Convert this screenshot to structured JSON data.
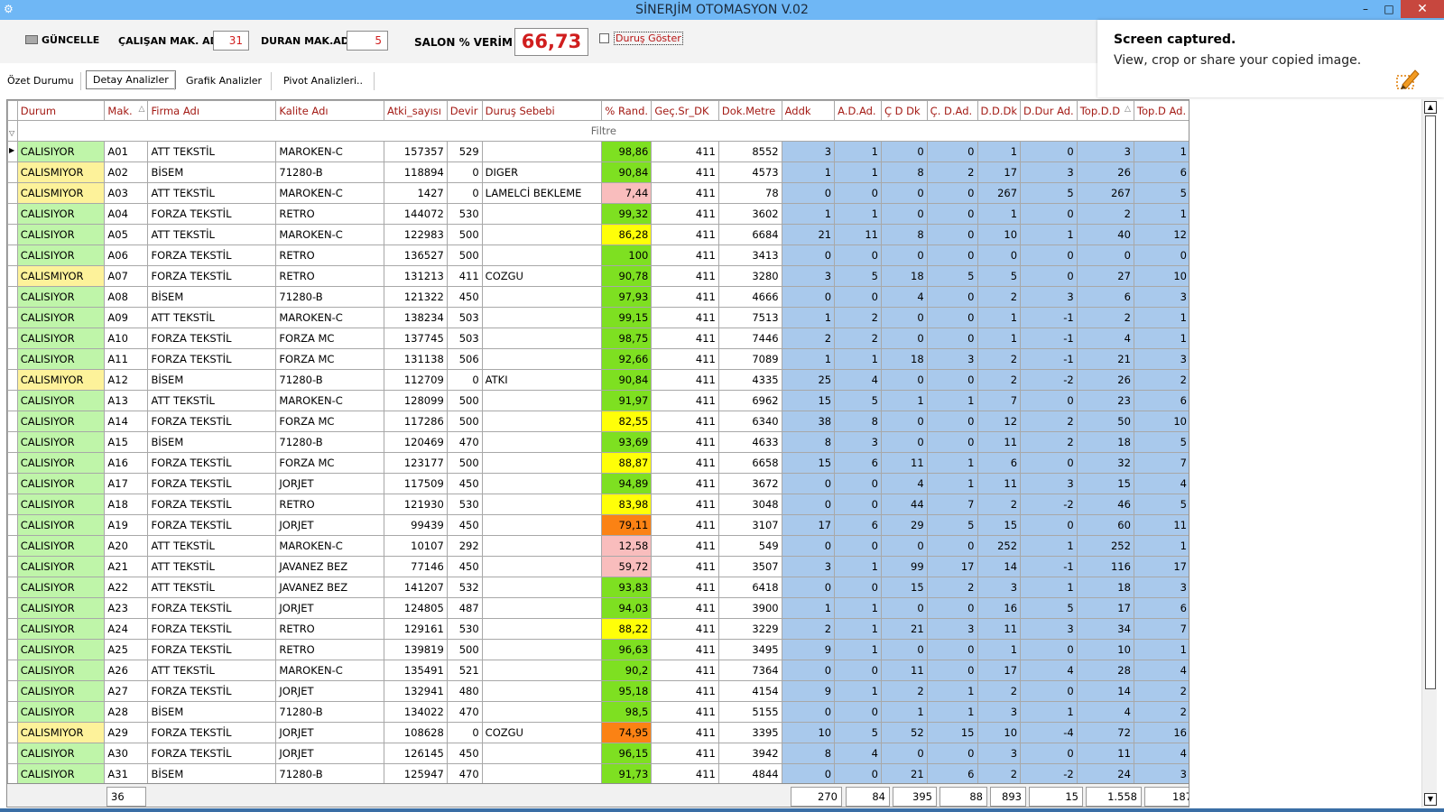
{
  "window": {
    "title": "SİNERJİM OTOMASYON V.02",
    "controls": {
      "minimize": "–",
      "maximize": "□",
      "close": "✕"
    }
  },
  "toolbar": {
    "refresh_label": "GÜNCELLE",
    "running_label": "ÇALIŞAN MAK. AD.",
    "running_value": "31",
    "stopped_label": "DURAN MAK.AD.",
    "stopped_value": "5",
    "efficiency_label": "SALON % VERİM",
    "efficiency_value": "66,73",
    "show_stops_label": "Duruş Göster"
  },
  "tabs": [
    "Özet Durumu",
    "Detay Analizler",
    "Grafik Analizler",
    "Pivot Analizleri.."
  ],
  "active_tab": 1,
  "notification": {
    "title": "Screen captured.",
    "body": "View, crop or share your copied image.",
    "icon": "snip-pen-icon"
  },
  "grid": {
    "filter_label": "Filtre",
    "columns": [
      "Durum",
      "Mak.",
      "Firma Adı",
      "Kalite Adı",
      "Atki_sayısı",
      "Devir",
      "Duruş Sebebi",
      "% Rand.",
      "Geç.Sr_DK",
      "Dok.Metre",
      "Addk",
      "A.D.Ad.",
      "Ç D Dk",
      "Ç. D.Ad.",
      "D.D.Dk",
      "D.Dur Ad.",
      "Top.D.D",
      "Top.D Ad."
    ],
    "sorted_columns": [
      1,
      16
    ],
    "colors": {
      "running": "#bff5a9",
      "stopped": "#fdf29a",
      "green": "#7ee021",
      "yellow": "#ffff08",
      "pink": "#f9bdbd",
      "orange": "#fb8214",
      "blue": "#a9c9ec"
    },
    "rows": [
      {
        "s": "on",
        "c": [
          "CALISIYOR",
          "A01",
          "ATT TEKSTİL",
          "MAROKEN-C",
          "157357",
          "529",
          "",
          "98,86",
          "411",
          "8552",
          "3",
          "1",
          "0",
          "0",
          "1",
          "0",
          "3",
          "1"
        ],
        "r": "green"
      },
      {
        "s": "off",
        "c": [
          "CALISMIYOR",
          "A02",
          "BİSEM",
          "71280-B",
          "118894",
          "0",
          "DIGER",
          "90,84",
          "411",
          "4573",
          "1",
          "1",
          "8",
          "2",
          "17",
          "3",
          "26",
          "6"
        ],
        "r": "green"
      },
      {
        "s": "off",
        "c": [
          "CALISMIYOR",
          "A03",
          "ATT TEKSTİL",
          "MAROKEN-C",
          "1427",
          "0",
          "LAMELCİ BEKLEME",
          "7,44",
          "411",
          "78",
          "0",
          "0",
          "0",
          "0",
          "267",
          "5",
          "267",
          "5"
        ],
        "r": "pink"
      },
      {
        "s": "on",
        "c": [
          "CALISIYOR",
          "A04",
          "FORZA TEKSTİL",
          "RETRO",
          "144072",
          "530",
          "",
          "99,32",
          "411",
          "3602",
          "1",
          "1",
          "0",
          "0",
          "1",
          "0",
          "2",
          "1"
        ],
        "r": "green"
      },
      {
        "s": "on",
        "c": [
          "CALISIYOR",
          "A05",
          "ATT TEKSTİL",
          "MAROKEN-C",
          "122983",
          "500",
          "",
          "86,28",
          "411",
          "6684",
          "21",
          "11",
          "8",
          "0",
          "10",
          "1",
          "40",
          "12"
        ],
        "r": "yellow"
      },
      {
        "s": "on",
        "c": [
          "CALISIYOR",
          "A06",
          "FORZA TEKSTİL",
          "RETRO",
          "136527",
          "500",
          "",
          "100",
          "411",
          "3413",
          "0",
          "0",
          "0",
          "0",
          "0",
          "0",
          "0",
          "0"
        ],
        "r": "green"
      },
      {
        "s": "off",
        "c": [
          "CALISMIYOR",
          "A07",
          "FORZA TEKSTİL",
          "RETRO",
          "131213",
          "411",
          "COZGU",
          "90,78",
          "411",
          "3280",
          "3",
          "5",
          "18",
          "5",
          "5",
          "0",
          "27",
          "10"
        ],
        "r": "green"
      },
      {
        "s": "on",
        "c": [
          "CALISIYOR",
          "A08",
          "BİSEM",
          "71280-B",
          "121322",
          "450",
          "",
          "97,93",
          "411",
          "4666",
          "0",
          "0",
          "4",
          "0",
          "2",
          "3",
          "6",
          "3"
        ],
        "r": "green"
      },
      {
        "s": "on",
        "c": [
          "CALISIYOR",
          "A09",
          "ATT TEKSTİL",
          "MAROKEN-C",
          "138234",
          "503",
          "",
          "99,15",
          "411",
          "7513",
          "1",
          "2",
          "0",
          "0",
          "1",
          "-1",
          "2",
          "1"
        ],
        "r": "green"
      },
      {
        "s": "on",
        "c": [
          "CALISIYOR",
          "A10",
          "FORZA TEKSTİL",
          "FORZA MC",
          "137745",
          "503",
          "",
          "98,75",
          "411",
          "7446",
          "2",
          "2",
          "0",
          "0",
          "1",
          "-1",
          "4",
          "1"
        ],
        "r": "green"
      },
      {
        "s": "on",
        "c": [
          "CALISIYOR",
          "A11",
          "FORZA TEKSTİL",
          "FORZA MC",
          "131138",
          "506",
          "",
          "92,66",
          "411",
          "7089",
          "1",
          "1",
          "18",
          "3",
          "2",
          "-1",
          "21",
          "3"
        ],
        "r": "green"
      },
      {
        "s": "off",
        "c": [
          "CALISMIYOR",
          "A12",
          "BİSEM",
          "71280-B",
          "112709",
          "0",
          "ATKI",
          "90,84",
          "411",
          "4335",
          "25",
          "4",
          "0",
          "0",
          "2",
          "-2",
          "26",
          "2"
        ],
        "r": "green"
      },
      {
        "s": "on",
        "c": [
          "CALISIYOR",
          "A13",
          "ATT TEKSTİL",
          "MAROKEN-C",
          "128099",
          "500",
          "",
          "91,97",
          "411",
          "6962",
          "15",
          "5",
          "1",
          "1",
          "7",
          "0",
          "23",
          "6"
        ],
        "r": "green"
      },
      {
        "s": "on",
        "c": [
          "CALISIYOR",
          "A14",
          "FORZA TEKSTİL",
          "FORZA MC",
          "117286",
          "500",
          "",
          "82,55",
          "411",
          "6340",
          "38",
          "8",
          "0",
          "0",
          "12",
          "2",
          "50",
          "10"
        ],
        "r": "yellow"
      },
      {
        "s": "on",
        "c": [
          "CALISIYOR",
          "A15",
          "BİSEM",
          "71280-B",
          "120469",
          "470",
          "",
          "93,69",
          "411",
          "4633",
          "8",
          "3",
          "0",
          "0",
          "11",
          "2",
          "18",
          "5"
        ],
        "r": "green"
      },
      {
        "s": "on",
        "c": [
          "CALISIYOR",
          "A16",
          "FORZA TEKSTİL",
          "FORZA MC",
          "123177",
          "500",
          "",
          "88,87",
          "411",
          "6658",
          "15",
          "6",
          "11",
          "1",
          "6",
          "0",
          "32",
          "7"
        ],
        "r": "yellow"
      },
      {
        "s": "on",
        "c": [
          "CALISIYOR",
          "A17",
          "FORZA TEKSTİL",
          "JORJET",
          "117509",
          "450",
          "",
          "94,89",
          "411",
          "3672",
          "0",
          "0",
          "4",
          "1",
          "11",
          "3",
          "15",
          "4"
        ],
        "r": "green"
      },
      {
        "s": "on",
        "c": [
          "CALISIYOR",
          "A18",
          "FORZA TEKSTİL",
          "RETRO",
          "121930",
          "530",
          "",
          "83,98",
          "411",
          "3048",
          "0",
          "0",
          "44",
          "7",
          "2",
          "-2",
          "46",
          "5"
        ],
        "r": "yellow"
      },
      {
        "s": "on",
        "c": [
          "CALISIYOR",
          "A19",
          "FORZA TEKSTİL",
          "JORJET",
          "99439",
          "450",
          "",
          "79,11",
          "411",
          "3107",
          "17",
          "6",
          "29",
          "5",
          "15",
          "0",
          "60",
          "11"
        ],
        "r": "orange"
      },
      {
        "s": "on",
        "c": [
          "CALISIYOR",
          "A20",
          "ATT TEKSTİL",
          "MAROKEN-C",
          "10107",
          "292",
          "",
          "12,58",
          "411",
          "549",
          "0",
          "0",
          "0",
          "0",
          "252",
          "1",
          "252",
          "1"
        ],
        "r": "pink"
      },
      {
        "s": "on",
        "c": [
          "CALISIYOR",
          "A21",
          "ATT TEKSTİL",
          "JAVANEZ BEZ",
          "77146",
          "450",
          "",
          "59,72",
          "411",
          "3507",
          "3",
          "1",
          "99",
          "17",
          "14",
          "-1",
          "116",
          "17"
        ],
        "r": "pink"
      },
      {
        "s": "on",
        "c": [
          "CALISIYOR",
          "A22",
          "ATT TEKSTİL",
          "JAVANEZ BEZ",
          "141207",
          "532",
          "",
          "93,83",
          "411",
          "6418",
          "0",
          "0",
          "15",
          "2",
          "3",
          "1",
          "18",
          "3"
        ],
        "r": "green"
      },
      {
        "s": "on",
        "c": [
          "CALISIYOR",
          "A23",
          "FORZA TEKSTİL",
          "JORJET",
          "124805",
          "487",
          "",
          "94,03",
          "411",
          "3900",
          "1",
          "1",
          "0",
          "0",
          "16",
          "5",
          "17",
          "6"
        ],
        "r": "green"
      },
      {
        "s": "on",
        "c": [
          "CALISIYOR",
          "A24",
          "FORZA TEKSTİL",
          "RETRO",
          "129161",
          "530",
          "",
          "88,22",
          "411",
          "3229",
          "2",
          "1",
          "21",
          "3",
          "11",
          "3",
          "34",
          "7"
        ],
        "r": "yellow"
      },
      {
        "s": "on",
        "c": [
          "CALISIYOR",
          "A25",
          "FORZA TEKSTİL",
          "RETRO",
          "139819",
          "500",
          "",
          "96,63",
          "411",
          "3495",
          "9",
          "1",
          "0",
          "0",
          "1",
          "0",
          "10",
          "1"
        ],
        "r": "green"
      },
      {
        "s": "on",
        "c": [
          "CALISIYOR",
          "A26",
          "ATT TEKSTİL",
          "MAROKEN-C",
          "135491",
          "521",
          "",
          "90,2",
          "411",
          "7364",
          "0",
          "0",
          "11",
          "0",
          "17",
          "4",
          "28",
          "4"
        ],
        "r": "green"
      },
      {
        "s": "on",
        "c": [
          "CALISIYOR",
          "A27",
          "FORZA TEKSTİL",
          "JORJET",
          "132941",
          "480",
          "",
          "95,18",
          "411",
          "4154",
          "9",
          "1",
          "2",
          "1",
          "2",
          "0",
          "14",
          "2"
        ],
        "r": "green"
      },
      {
        "s": "on",
        "c": [
          "CALISIYOR",
          "A28",
          "BİSEM",
          "71280-B",
          "134022",
          "470",
          "",
          "98,5",
          "411",
          "5155",
          "0",
          "0",
          "1",
          "1",
          "3",
          "1",
          "4",
          "2"
        ],
        "r": "green"
      },
      {
        "s": "off",
        "c": [
          "CALISMIYOR",
          "A29",
          "FORZA TEKSTİL",
          "JORJET",
          "108628",
          "0",
          "COZGU",
          "74,95",
          "411",
          "3395",
          "10",
          "5",
          "52",
          "15",
          "10",
          "-4",
          "72",
          "16"
        ],
        "r": "orange"
      },
      {
        "s": "on",
        "c": [
          "CALISIYOR",
          "A30",
          "FORZA TEKSTİL",
          "JORJET",
          "126145",
          "450",
          "",
          "96,15",
          "411",
          "3942",
          "8",
          "4",
          "0",
          "0",
          "3",
          "0",
          "11",
          "4"
        ],
        "r": "green"
      },
      {
        "s": "on",
        "c": [
          "CALISIYOR",
          "A31",
          "BİSEM",
          "71280-B",
          "125947",
          "470",
          "",
          "91,73",
          "411",
          "4844",
          "0",
          "0",
          "21",
          "6",
          "2",
          "-2",
          "24",
          "3"
        ],
        "r": "green"
      }
    ],
    "totals": {
      "count": "36",
      "addk": "270",
      "ad_ad": "84",
      "cd_dk": "395",
      "cd_ad": "88",
      "dd_dk": "893",
      "dd_ad": "15",
      "top_dd": "1.558",
      "top_ad": "187"
    }
  }
}
